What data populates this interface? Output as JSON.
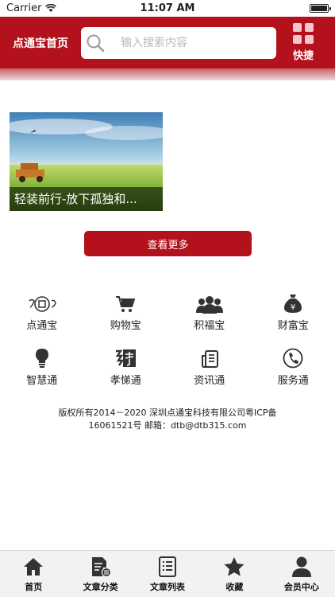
{
  "status_bar": {
    "carrier": "Carrier",
    "time": "11:07 AM"
  },
  "header": {
    "title": "点通宝首页",
    "search_placeholder": "输入搜索内容",
    "quick_label": "快捷"
  },
  "colors": {
    "brand": "#b3111b",
    "tab_bg": "#f2f2f2"
  },
  "article": {
    "caption": "轻装前行-放下孤独和..."
  },
  "more_button": {
    "label": "查看更多"
  },
  "services": [
    {
      "label": "点通宝",
      "icon": "dtb-logo-icon"
    },
    {
      "label": "购物宝",
      "icon": "shopping-cart-icon"
    },
    {
      "label": "积福宝",
      "icon": "people-group-icon"
    },
    {
      "label": "财富宝",
      "icon": "money-bag-icon"
    },
    {
      "label": "智慧通",
      "icon": "lightbulb-icon"
    },
    {
      "label": "孝悌通",
      "icon": "filial-icon"
    },
    {
      "label": "资讯通",
      "icon": "news-icon"
    },
    {
      "label": "服务通",
      "icon": "phone-icon"
    }
  ],
  "footer": {
    "line1": "版权所有2014－2020 深圳点通宝科技有限公司粤ICP备",
    "line2": "16061521号 邮箱：dtb@dtb315.com"
  },
  "tabs": [
    {
      "label": "首页",
      "icon": "home-icon"
    },
    {
      "label": "文章分类",
      "icon": "article-category-icon"
    },
    {
      "label": "文章列表",
      "icon": "article-list-icon"
    },
    {
      "label": "收藏",
      "icon": "star-icon"
    },
    {
      "label": "会员中心",
      "icon": "user-icon"
    }
  ]
}
